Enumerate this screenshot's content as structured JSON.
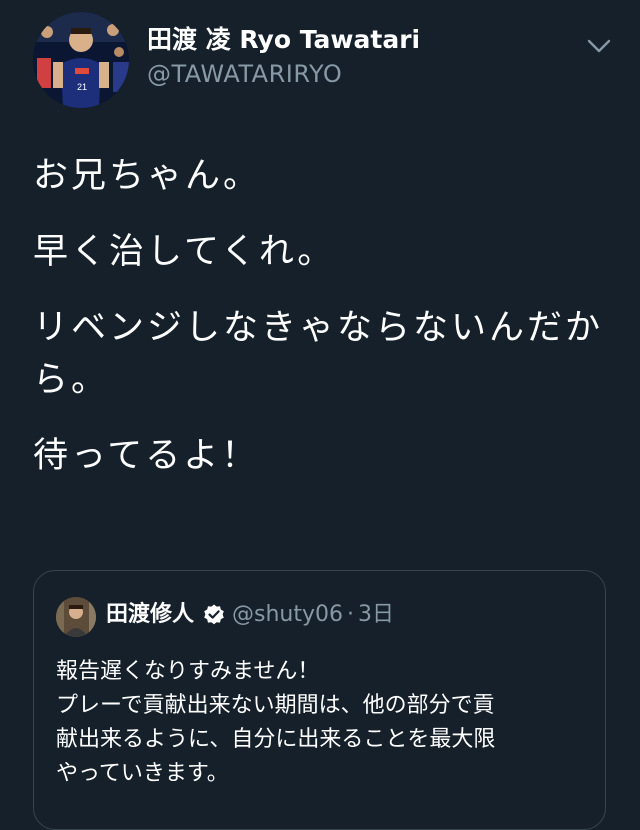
{
  "author": {
    "display_name": "田渡 凌 Ryo Tawatari",
    "handle": "@TAWATARIRYO",
    "avatar_icon": "basketball-player-avatar"
  },
  "tweet": {
    "paragraphs": [
      "お兄ちゃん。",
      "早く治してくれ。",
      "リベンジしなきゃならないんだから。",
      "待ってるよ！"
    ]
  },
  "quoted_tweet": {
    "display_name": "田渡修人",
    "verified_icon": "verified-badge-icon",
    "handle": "@shuty06",
    "separator": "·",
    "time": "3日",
    "lines": [
      "報告遅くなりすみません！",
      "プレーで貢献出来ない期間は、他の部分で貢",
      "献出来るように、自分に出来ることを最大限",
      "やっていきます。"
    ]
  },
  "colors": {
    "background": "#15202b",
    "text_primary": "#ffffff",
    "text_secondary": "#8899a6",
    "border": "#38444d"
  }
}
